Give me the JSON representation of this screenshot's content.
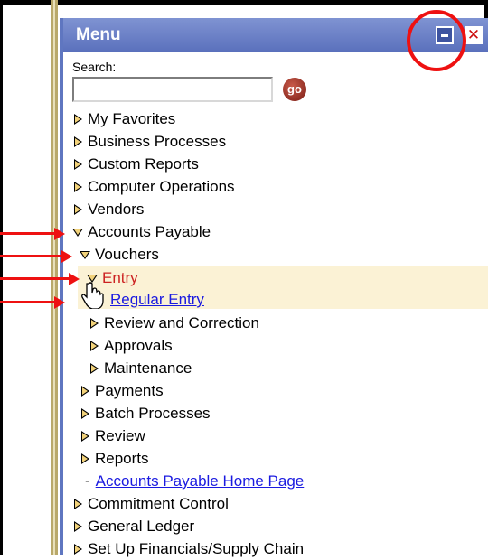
{
  "menu": {
    "title": "Menu",
    "minimize_icon": "minimize-icon",
    "close_icon": "close-icon",
    "close_glyph": "✕"
  },
  "search": {
    "label": "Search:",
    "value": "",
    "go_label": "go"
  },
  "tree": {
    "my_favorites": "My Favorites",
    "business_processes": "Business Processes",
    "custom_reports": "Custom Reports",
    "computer_operations": "Computer Operations",
    "vendors": "Vendors",
    "accounts_payable": "Accounts Payable",
    "vouchers": "Vouchers",
    "entry": "Entry",
    "regular_entry": "Regular Entry",
    "review_and_correction": "Review and Correction",
    "approvals": "Approvals",
    "maintenance": "Maintenance",
    "payments": "Payments",
    "batch_processes": "Batch Processes",
    "review": "Review",
    "reports": "Reports",
    "ap_home_page": "Accounts Payable Home Page",
    "commitment_control": "Commitment Control",
    "general_ledger": "General Ledger",
    "set_up_financials": "Set Up Financials/Supply Chain"
  },
  "colors": {
    "header": "#5a70bc",
    "highlight_bg": "#fbf2d5",
    "entry_text": "#cc2222",
    "link": "#1a1ae0",
    "annotation": "#ee1111"
  }
}
